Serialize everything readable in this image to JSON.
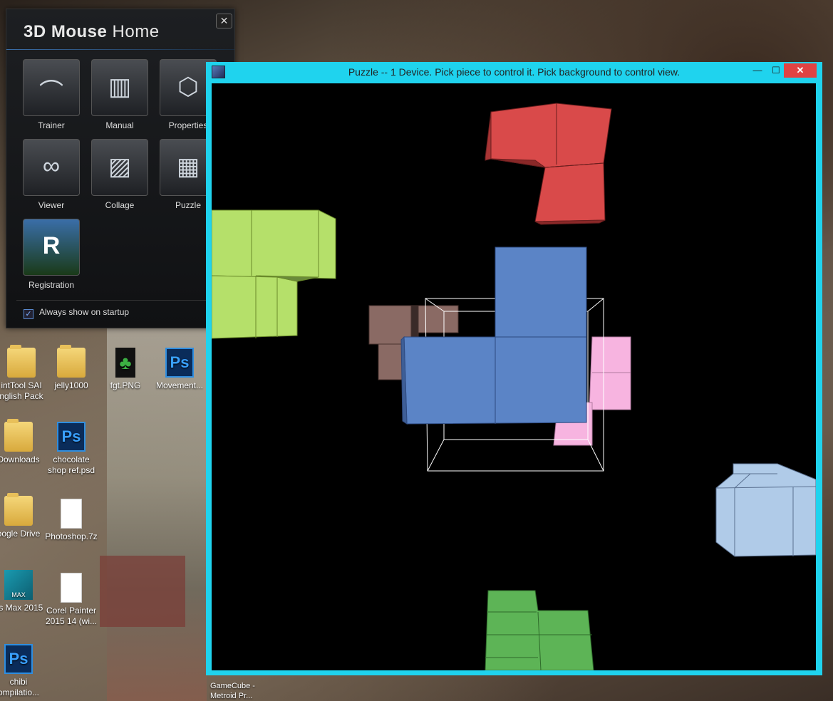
{
  "home": {
    "title_bold": "3D Mouse",
    "title_rest": " Home",
    "close": "✕",
    "tiles": [
      {
        "label": "Trainer",
        "glyph": "⌒"
      },
      {
        "label": "Manual",
        "glyph": "▥"
      },
      {
        "label": "Properties",
        "glyph": "⬡"
      },
      {
        "label": "Viewer",
        "glyph": "∞"
      },
      {
        "label": "Collage",
        "glyph": "▨"
      },
      {
        "label": "Puzzle",
        "glyph": "▦"
      },
      {
        "label": "Registration",
        "glyph": "R"
      }
    ],
    "startup_label": "Always show on startup",
    "startup_checked": "✓"
  },
  "desktop": {
    "icons": [
      {
        "label": "intTool SAI\nnglish Pack"
      },
      {
        "label": "jelly1000"
      },
      {
        "label": "fgt.PNG"
      },
      {
        "label": "Movement..."
      },
      {
        "label": "Downloads"
      },
      {
        "label": "chocolate\nshop ref.psd"
      },
      {
        "label": "oogle Drive"
      },
      {
        "label": "Photoshop.7z"
      },
      {
        "label": "ds Max 2015"
      },
      {
        "label": "Corel Painter\n2015 14 (wi..."
      },
      {
        "label": "chibi\nompilatio..."
      }
    ],
    "ps_glyph": "Ps",
    "max_glyph": "MAX",
    "taskbar_item": "GameCube -\nMetroid Pr..."
  },
  "puzzle_window": {
    "title": "Puzzle -- 1 Device.  Pick piece to control it.  Pick background to control view.",
    "min": "—",
    "max": "☐",
    "close": "✕"
  },
  "pieces": [
    {
      "name": "red",
      "color": "#d94a4a"
    },
    {
      "name": "lime",
      "color": "#b5e06a"
    },
    {
      "name": "blue",
      "color": "#5b84c6"
    },
    {
      "name": "brown",
      "color": "#8a6a64"
    },
    {
      "name": "pink",
      "color": "#f7b4e0"
    },
    {
      "name": "lightblue",
      "color": "#b0cbe8"
    },
    {
      "name": "green",
      "color": "#5db456"
    }
  ]
}
